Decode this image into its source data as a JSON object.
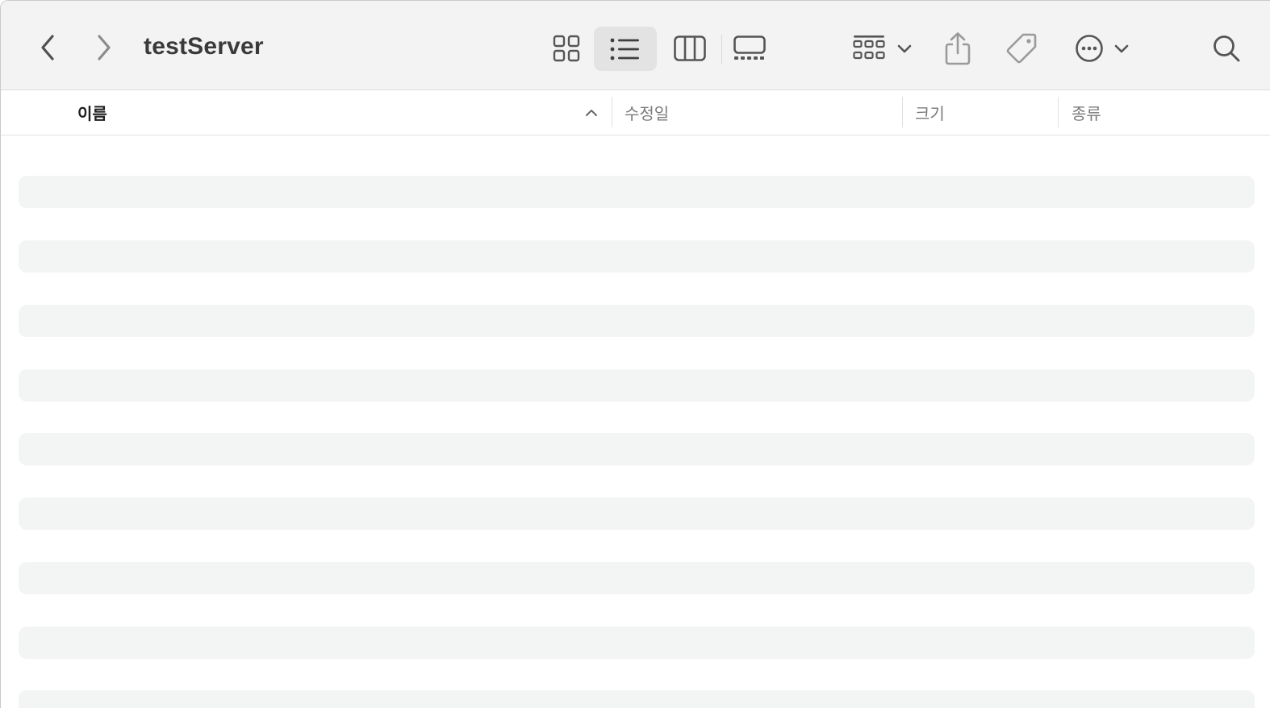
{
  "window": {
    "title": "testServer"
  },
  "toolbar": {
    "back_icon": "chevron-left-icon",
    "forward_icon": "chevron-right-icon",
    "view_modes": [
      "icons",
      "list",
      "columns",
      "gallery"
    ],
    "active_view": "list",
    "group_icon": "group-grid-icon",
    "share_icon": "share-icon",
    "tag_icon": "tag-icon",
    "more_icon": "ellipsis-circle-icon",
    "search_icon": "search-icon"
  },
  "columns": {
    "name": "이름",
    "date_modified": "수정일",
    "size": "크기",
    "kind": "종류",
    "sort_column": "name",
    "sort_direction": "ascending"
  },
  "list": {
    "state": "loading",
    "placeholder_rows": 9
  },
  "colors": {
    "toolbar_bg": "#f3f3f3",
    "active_view_bg": "#e3e3e3",
    "placeholder_row": "#f3f4f4",
    "icon_color": "#5a5a5a"
  }
}
